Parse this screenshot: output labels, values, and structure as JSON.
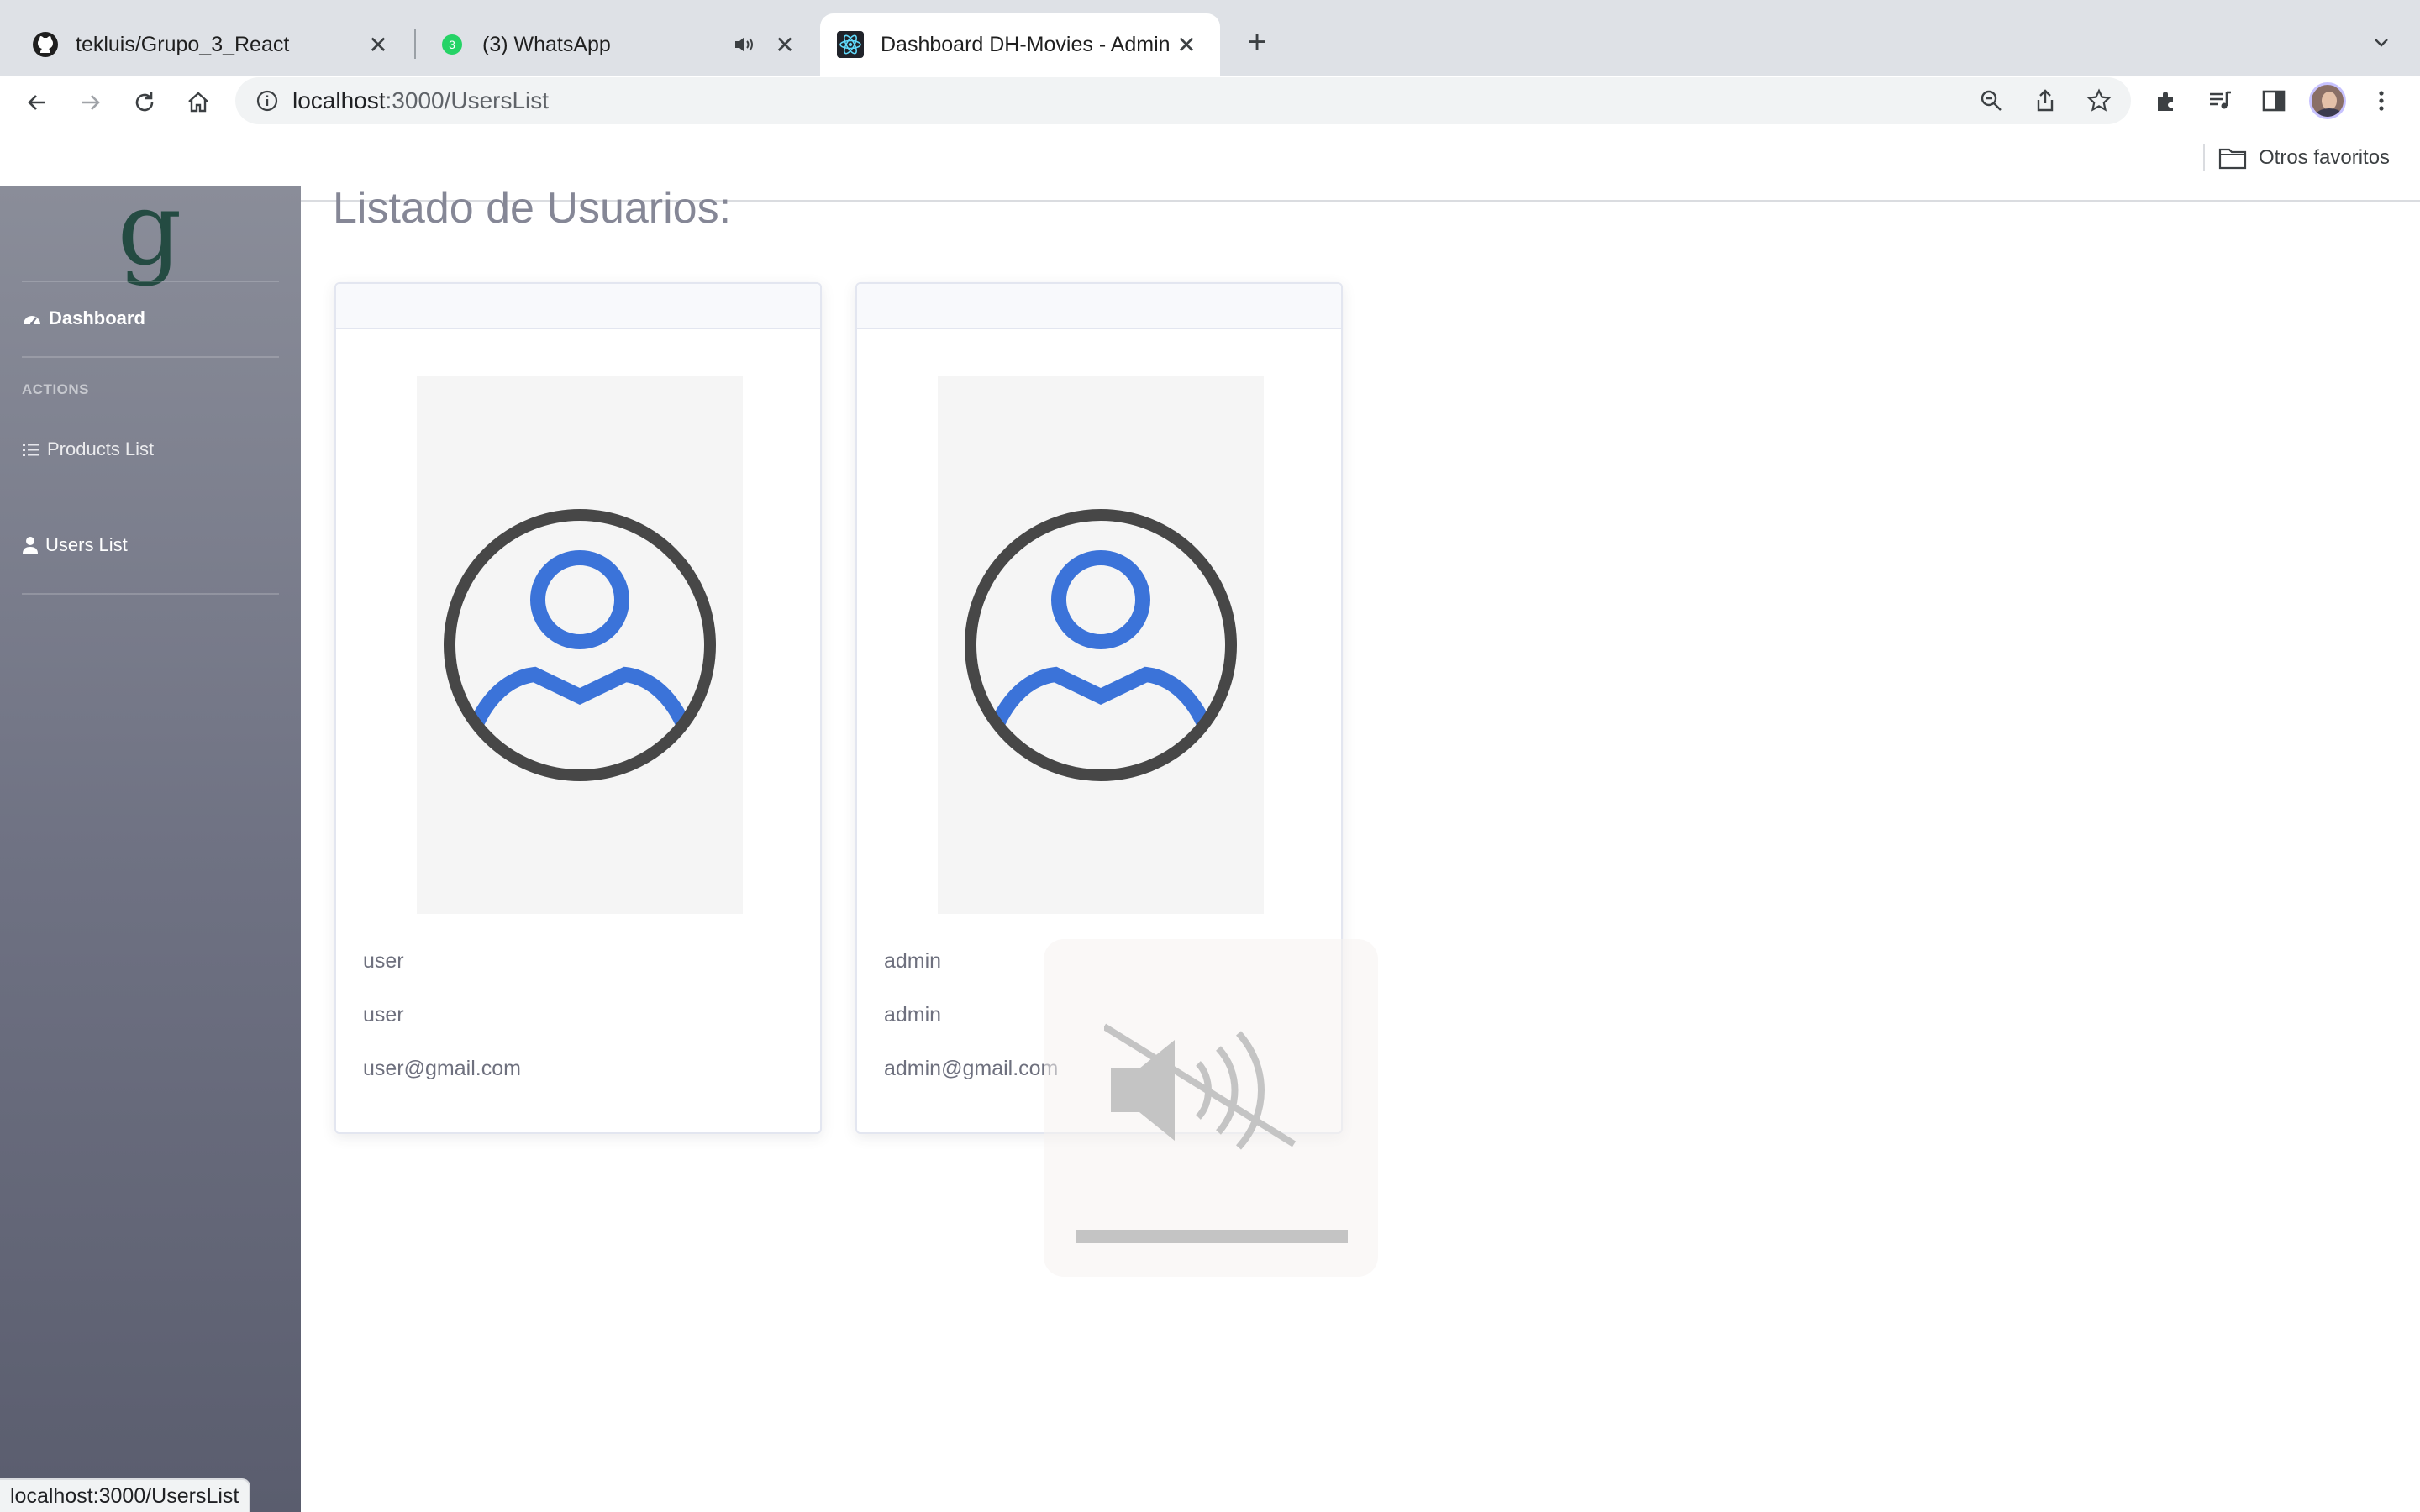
{
  "browser": {
    "tabs": [
      {
        "title": "tekluis/Grupo_3_React",
        "icon": "github-icon"
      },
      {
        "title": "(3) WhatsApp",
        "icon": "whatsapp-icon",
        "badge": "3"
      },
      {
        "title": "Dashboard DH-Movies - Admin",
        "icon": "react-icon",
        "active": true
      }
    ],
    "url_host": "localhost",
    "url_rest": ":3000/UsersList",
    "bookmark_folder": "Otros favoritos",
    "status_url": "localhost:3000/UsersList"
  },
  "sidebar": {
    "logo_text": "g",
    "dashboard_label": "Dashboard",
    "actions_heading": "ACTIONS",
    "products_label": "Products List",
    "users_label": "Users List"
  },
  "page": {
    "title": "Listado de Usuarios:"
  },
  "users": [
    {
      "first_name": "user",
      "last_name": "user",
      "email": "user@gmail.com"
    },
    {
      "first_name": "admin",
      "last_name": "admin",
      "email": "admin@gmail.com"
    }
  ],
  "colors": {
    "accent_blue": "#3b73d9",
    "avatar_ring": "#474747",
    "sidebar_top": "#8a8d99",
    "sidebar_bottom": "#5a5d6e",
    "logo_green": "#244b42"
  }
}
